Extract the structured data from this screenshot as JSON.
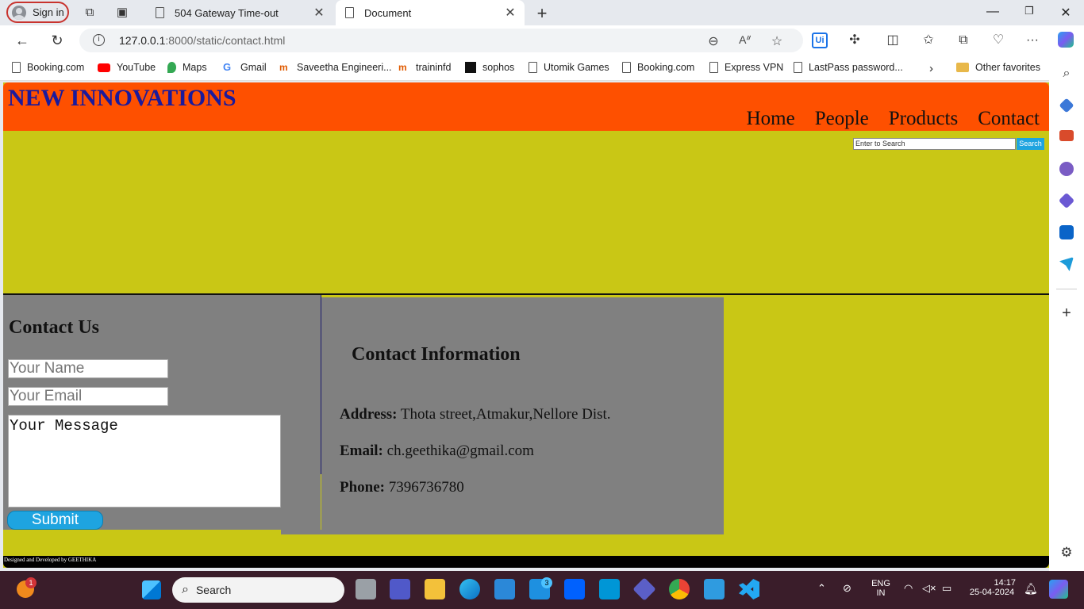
{
  "browser": {
    "signin_label": "Sign in",
    "tabs": [
      {
        "title": "504 Gateway Time-out"
      },
      {
        "title": "Document"
      }
    ],
    "url_host": "127.0.0.1",
    "url_path": ":8000/static/contact.html",
    "bookmarks": [
      {
        "label": "Booking.com",
        "icon": "booking-icon"
      },
      {
        "label": "YouTube",
        "icon": "youtube-icon"
      },
      {
        "label": "Maps",
        "icon": "maps-icon"
      },
      {
        "label": "Gmail",
        "icon": "google-icon"
      },
      {
        "label": "Saveetha Engineeri...",
        "icon": "training-icon"
      },
      {
        "label": "traininfd",
        "icon": "training-icon"
      },
      {
        "label": "sophos",
        "icon": "sophos-icon"
      },
      {
        "label": "Utomik Games",
        "icon": "page-icon"
      },
      {
        "label": "Booking.com",
        "icon": "page-icon"
      },
      {
        "label": "Express VPN",
        "icon": "page-icon"
      },
      {
        "label": "LastPass password...",
        "icon": "page-icon"
      }
    ],
    "other_favorites": "Other favorites"
  },
  "site": {
    "logo": "NEW INNOVATIONS",
    "nav": [
      "Home",
      "People",
      "Products",
      "Contact"
    ],
    "search_placeholder": "Enter to Search",
    "search_button": "Search",
    "contact": {
      "title": "Contact Us",
      "name_placeholder": "Your Name",
      "email_placeholder": "Your Email",
      "message_placeholder": "Your Message",
      "submit": "Submit"
    },
    "info": {
      "title": "Contact Information",
      "address_label": "Address:",
      "address_value": "Thota street,Atmakur,Nellore Dist.",
      "email_label": "Email:",
      "email_value": "ch.geethika@gmail.com",
      "phone_label": "Phone:",
      "phone_value": "7396736780"
    },
    "footer": "Designed and Developed by GEETHIKA"
  },
  "taskbar": {
    "search_label": "Search",
    "lang_line1": "ENG",
    "lang_line2": "IN",
    "time": "14:17",
    "date": "25-04-2024",
    "notif_badge": "1",
    "mail_badge": "3"
  },
  "colors": {
    "header": "#fe5000",
    "page_bg": "#c9c715",
    "panel": "#808080",
    "accent": "#1ea4e0",
    "logo": "#1a1a9c"
  }
}
